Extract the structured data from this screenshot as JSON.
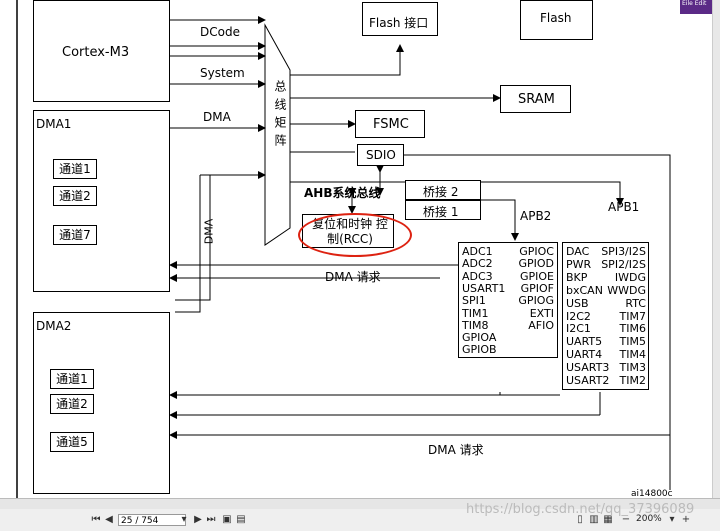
{
  "diagram": {
    "cpu": "Cortex-M3",
    "buses": {
      "dcode": "DCode",
      "system": "System",
      "dma": "DMA",
      "dma_vertical": "DMA"
    },
    "matrix_label": "总线矩阵",
    "flash_if": "Flash 接口",
    "flash": "Flash",
    "sram": "SRAM",
    "fsmc": "FSMC",
    "sdio": "SDIO",
    "ahb": "AHB系统总线",
    "bridge2": "桥接 2",
    "bridge1": "桥接 1",
    "rcc": "复位和时钟 控制(RCC)",
    "apb2": "APB2",
    "apb1": "APB1",
    "dma1": {
      "title": "DMA1",
      "channels": [
        "通道1",
        "通道2",
        "通道7"
      ]
    },
    "dma2": {
      "title": "DMA2",
      "channels": [
        "通道1",
        "通道2",
        "通道5"
      ]
    },
    "dma_request": "DMA 请求",
    "dma_request2": "DMA 请求",
    "apb2_left": [
      "ADC1",
      "ADC2",
      "ADC3",
      "USART1",
      "SPI1",
      "TIM1",
      "TIM8",
      "GPIOA",
      "GPIOB"
    ],
    "apb2_right": [
      "GPIOC",
      "GPIOD",
      "GPIOE",
      "GPIOF",
      "GPIOG",
      "EXTI",
      "AFIO"
    ],
    "apb1_left": [
      "DAC",
      "PWR",
      "BKP",
      "bxCAN",
      "USB",
      "I2C2",
      "I2C1",
      "UART5",
      "UART4",
      "USART3",
      "USART2"
    ],
    "apb1_right": [
      "SPI3/I2S",
      "SPI2/I2S",
      "IWDG",
      "WWDG",
      "RTC",
      "TIM7",
      "TIM6",
      "TIM5",
      "TIM4",
      "TIM3",
      "TIM2"
    ],
    "figure_id": "ai14800c"
  },
  "toolbar": {
    "page_value": "25 / 754",
    "zoom": "200%",
    "watermark": "https://blog.csdn.net/qq_37396089"
  }
}
